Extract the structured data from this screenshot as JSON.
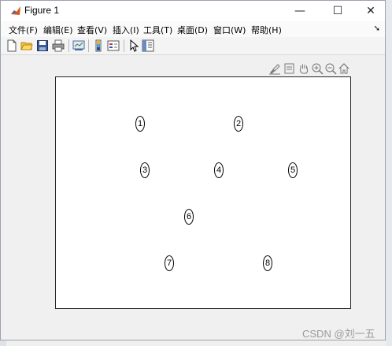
{
  "window": {
    "title": "Figure 1",
    "controls": {
      "minimize": "—",
      "maximize": "☐",
      "close": "✕"
    }
  },
  "menu": [
    "文件(F)",
    "编辑(E)",
    "查看(V)",
    "插入(I)",
    "工具(T)",
    "桌面(D)",
    "窗口(W)",
    "帮助(H)"
  ],
  "toolbar_icons": [
    "new-figure-icon",
    "open-file-icon",
    "save-icon",
    "print-icon",
    "link-plot-icon",
    "insert-colorbar-icon",
    "insert-legend-icon",
    "pointer-icon",
    "property-inspector-icon"
  ],
  "axes_toolbar_icons": [
    "brush-icon",
    "datatip-icon",
    "pan-icon",
    "zoom-in-icon",
    "zoom-out-icon",
    "home-icon"
  ],
  "nodes": [
    "1",
    "2",
    "3",
    "4",
    "5",
    "6",
    "7",
    "8"
  ],
  "watermark": "CSDN @刘一五"
}
